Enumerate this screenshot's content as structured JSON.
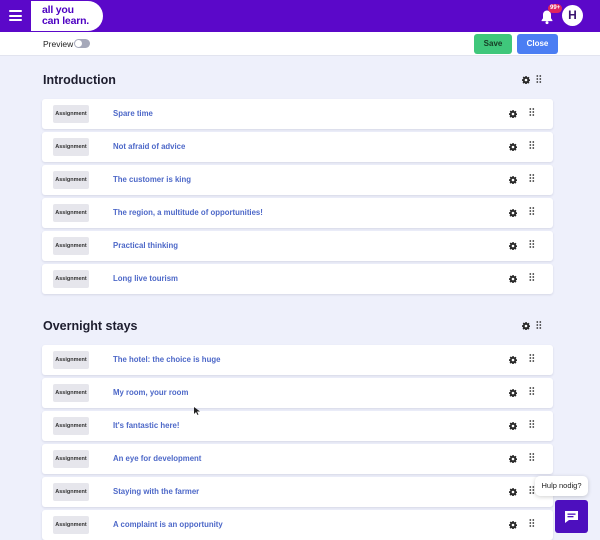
{
  "header": {
    "logo_line1": "all you",
    "logo_line2": "can learn.",
    "notification_badge": "99+",
    "avatar_initial": "H"
  },
  "toolbar": {
    "preview_label": "Preview",
    "preview_enabled": false,
    "save_label": "Save",
    "close_label": "Close"
  },
  "sections": [
    {
      "title": "Introduction",
      "items": [
        {
          "type": "Assignment",
          "title": "Spare time"
        },
        {
          "type": "Assignment",
          "title": "Not afraid of advice"
        },
        {
          "type": "Assignment",
          "title": "The customer is king"
        },
        {
          "type": "Assignment",
          "title": "The region, a multitude of opportunities!"
        },
        {
          "type": "Assignment",
          "title": "Practical thinking"
        },
        {
          "type": "Assignment",
          "title": "Long live tourism"
        }
      ]
    },
    {
      "title": "Overnight stays",
      "items": [
        {
          "type": "Assignment",
          "title": "The hotel: the choice is huge"
        },
        {
          "type": "Assignment",
          "title": "My room, your room"
        },
        {
          "type": "Assignment",
          "title": "It's fantastic here!"
        },
        {
          "type": "Assignment",
          "title": "An eye for development"
        },
        {
          "type": "Assignment",
          "title": "Staying with the farmer"
        },
        {
          "type": "Assignment",
          "title": "A complaint is an opportunity"
        }
      ]
    }
  ],
  "help": {
    "bubble_text": "Hulp nodig?"
  },
  "colors": {
    "topbar": "#5b08c9",
    "save": "#3fc77b",
    "close": "#4b7ef3",
    "link": "#4d68c8",
    "chat": "#4d0fbe"
  }
}
